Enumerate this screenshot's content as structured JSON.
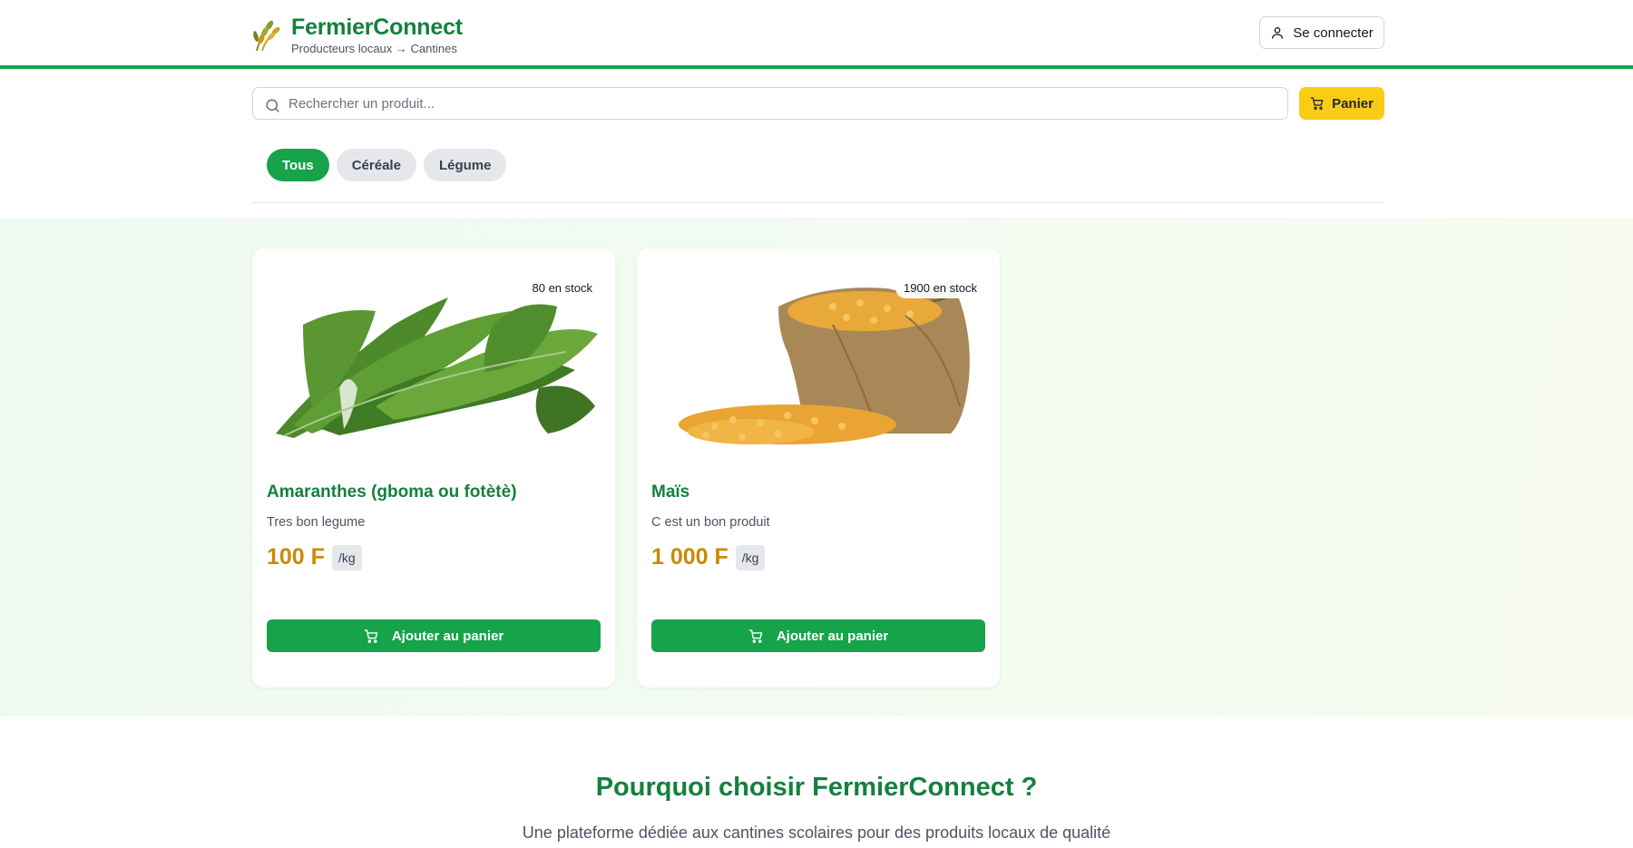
{
  "header": {
    "brand_title": "FermierConnect",
    "brand_subtitle": "Producteurs locaux → Cantines",
    "logo_icon": "wheat-icon",
    "login_label": "Se connecter"
  },
  "search": {
    "placeholder": "Rechercher un produit...",
    "value": "",
    "cart_label": "Panier"
  },
  "filters": [
    {
      "label": "Tous",
      "active": true
    },
    {
      "label": "Céréale",
      "active": false
    },
    {
      "label": "Légume",
      "active": false
    }
  ],
  "products": [
    {
      "name": "Amaranthes (gboma ou fotètè)",
      "description": "Tres bon legume",
      "price": "100 F",
      "unit": "/kg",
      "stock": "80 en stock",
      "add_label": "Ajouter au panier",
      "image": "leafy-greens-image"
    },
    {
      "name": "Maïs",
      "description": "C est un bon produit",
      "price": "1 000 F",
      "unit": "/kg",
      "stock": "1900 en stock",
      "add_label": "Ajouter au panier",
      "image": "corn-sack-image"
    }
  ],
  "why": {
    "title": "Pourquoi choisir FermierConnect ?",
    "subtitle": "Une plateforme dédiée aux cantines scolaires pour des produits locaux de qualité"
  },
  "colors": {
    "primary": "#16a34a",
    "primary_dark": "#15803d",
    "accent": "#facc15",
    "price": "#ca8a04"
  }
}
